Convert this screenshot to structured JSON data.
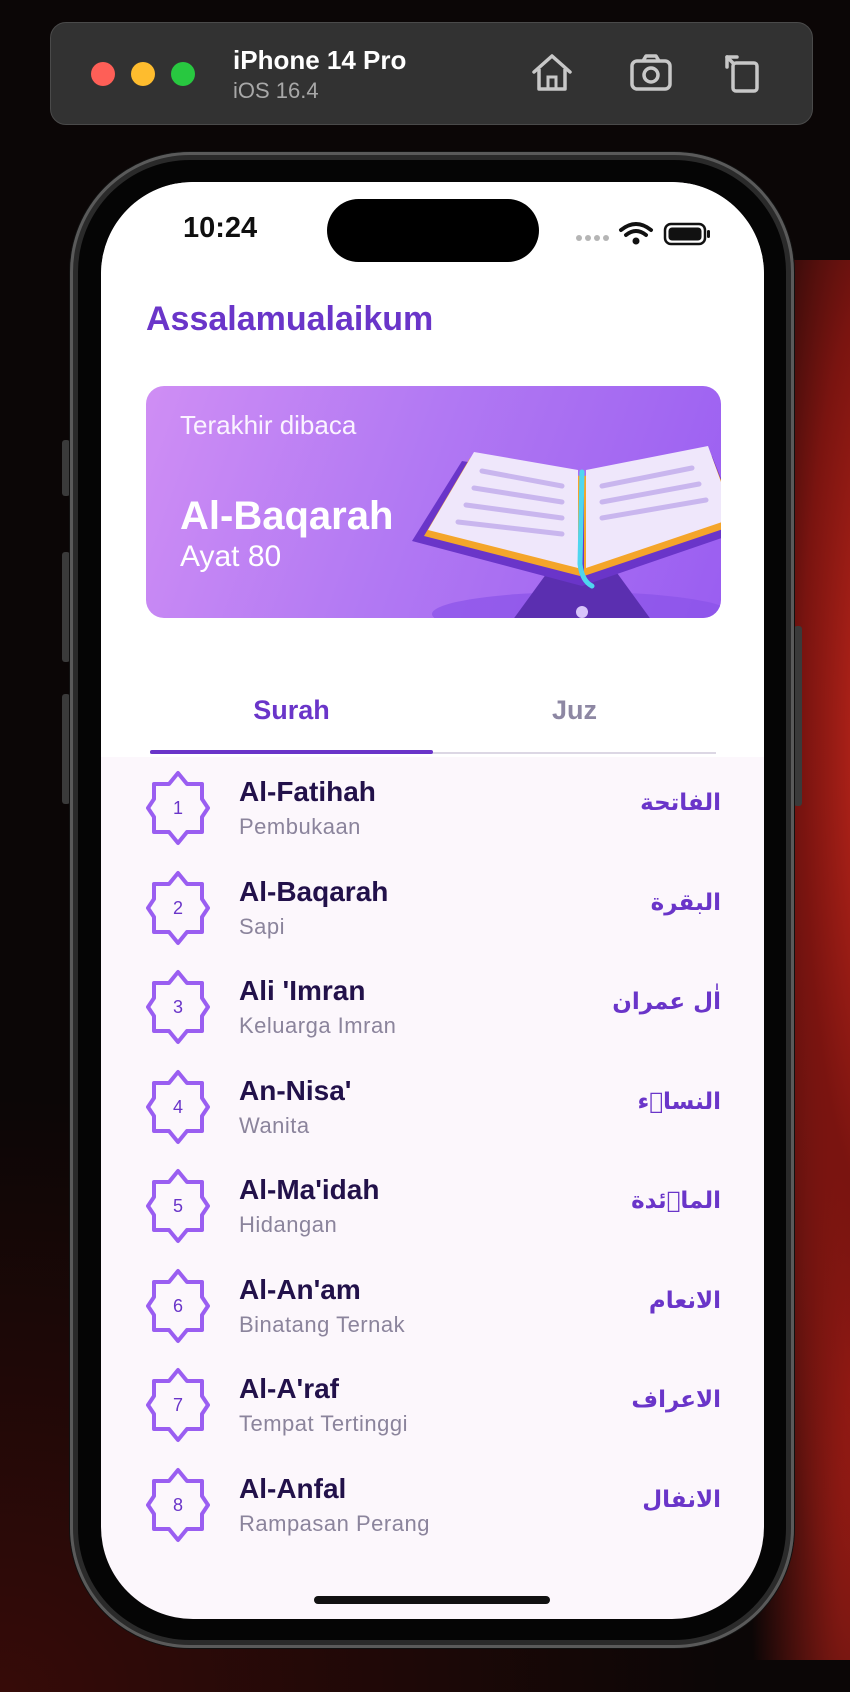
{
  "simulator": {
    "device_name": "iPhone 14 Pro",
    "os_version": "iOS 16.4"
  },
  "status_bar": {
    "time": "10:24"
  },
  "app": {
    "greeting": "Assalamualaikum",
    "last_read": {
      "label": "Terakhir dibaca",
      "surah": "Al-Baqarah",
      "ayat": "Ayat 80"
    },
    "tabs": [
      {
        "label": "Surah",
        "active": true
      },
      {
        "label": "Juz",
        "active": false
      }
    ],
    "surahs": [
      {
        "number": "1",
        "name": "Al-Fatihah",
        "meaning": "Pembukaan",
        "arabic": "الفاتحة"
      },
      {
        "number": "2",
        "name": "Al-Baqarah",
        "meaning": "Sapi",
        "arabic": "البقرة"
      },
      {
        "number": "3",
        "name": "Ali 'Imran",
        "meaning": "Keluarga Imran",
        "arabic": "اٰل عمران"
      },
      {
        "number": "4",
        "name": "An-Nisa'",
        "meaning": "Wanita",
        "arabic": "النساۤء"
      },
      {
        "number": "5",
        "name": "Al-Ma'idah",
        "meaning": "Hidangan",
        "arabic": "الماۤئدة"
      },
      {
        "number": "6",
        "name": "Al-An'am",
        "meaning": "Binatang Ternak",
        "arabic": "الانعام"
      },
      {
        "number": "7",
        "name": "Al-A'raf",
        "meaning": "Tempat Tertinggi",
        "arabic": "الاعراف"
      },
      {
        "number": "8",
        "name": "Al-Anfal",
        "meaning": "Rampasan Perang",
        "arabic": "الانفال"
      }
    ]
  },
  "colors": {
    "accent": "#6a35c9",
    "card_gradient_start": "#cf8ef4",
    "card_gradient_end": "#9a5ef1",
    "screen_background": "#fcf7fc",
    "title_text": "#22114a",
    "muted_text": "#8b849c"
  },
  "icons": [
    "home-icon",
    "screenshot-icon",
    "rotate-icon",
    "signal-dots-icon",
    "wifi-icon",
    "battery-icon",
    "octagram-number-badge-icon",
    "open-quran-illustration"
  ]
}
